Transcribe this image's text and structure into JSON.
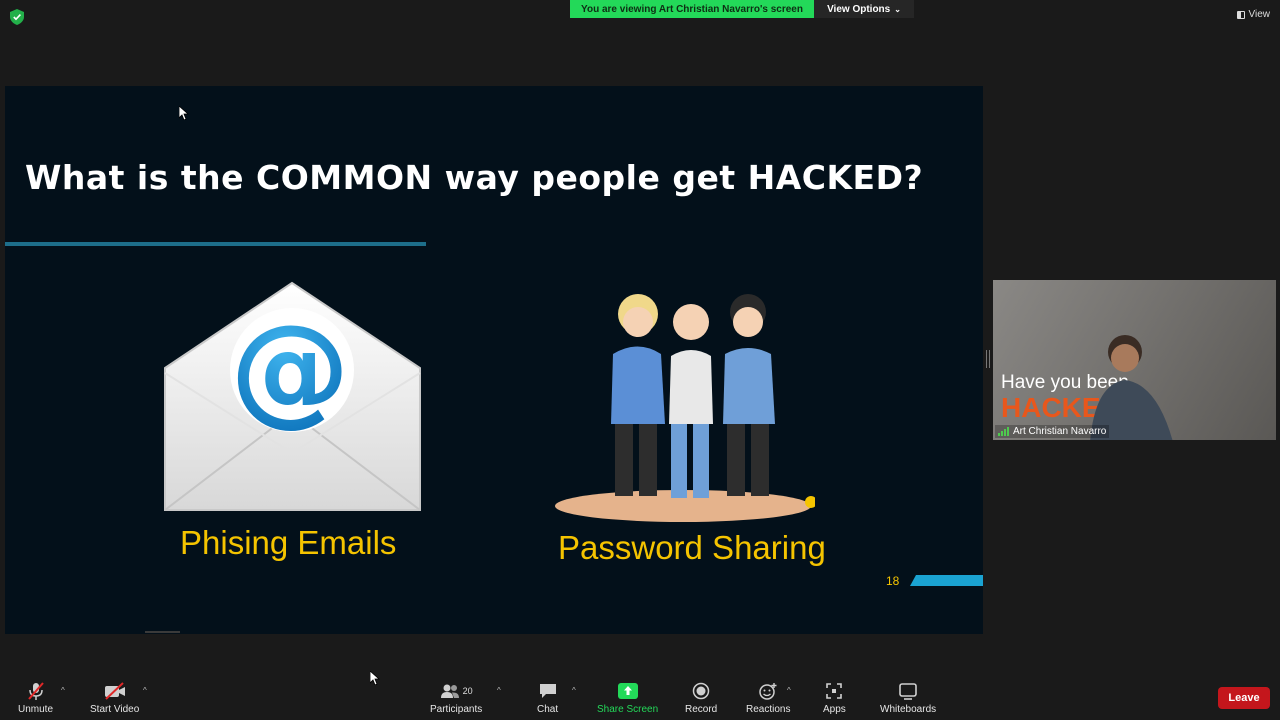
{
  "top": {
    "banner": "You are viewing Art Christian Navarro's screen",
    "view_options": "View Options",
    "view": "View"
  },
  "slide": {
    "title": "What is the COMMON way people get HACKED?",
    "item1_label": "Phising Emails",
    "item2_label": "Password Sharing",
    "page_number": "18"
  },
  "video": {
    "overlay_line1": "Have you been",
    "overlay_line2": "HACKED",
    "participant_name": "Art Christian Navarro"
  },
  "toolbar": {
    "unmute": "Unmute",
    "start_video": "Start Video",
    "participants": "Participants",
    "participant_count": "20",
    "chat": "Chat",
    "share_screen": "Share Screen",
    "record": "Record",
    "reactions": "Reactions",
    "apps": "Apps",
    "whiteboards": "Whiteboards",
    "leave": "Leave"
  },
  "colors": {
    "banner_green": "#23d959",
    "share_green": "#23d959",
    "leave_red": "#c4161c",
    "slide_bg": "#03101a",
    "accent_yellow": "#f5c400",
    "accent_blue": "#1aa3d2"
  }
}
